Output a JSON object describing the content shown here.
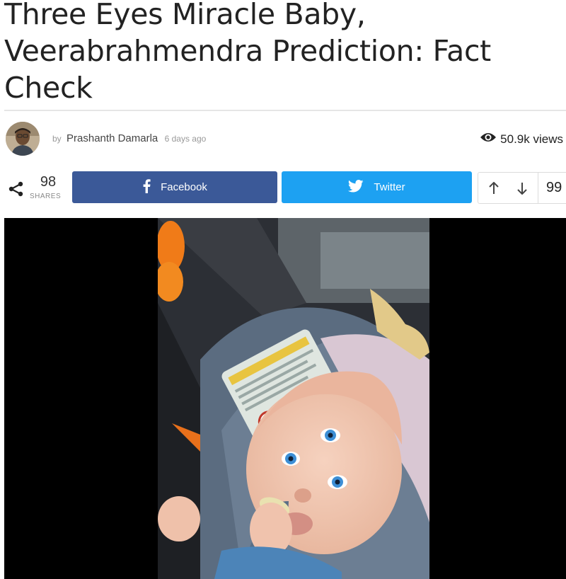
{
  "article": {
    "title_lines": [
      "Three Eyes Miracle Baby,",
      "Veerabrahmendra Prediction: Fact",
      "Check"
    ]
  },
  "meta": {
    "by_label": "by",
    "author": "Prashanth Damarla",
    "date": "6 days ago",
    "views": "50.9k views"
  },
  "share": {
    "count": "98",
    "count_label": "SHARES",
    "facebook_label": "Facebook",
    "twitter_label": "Twitter",
    "facebook_color": "#3b5998",
    "twitter_color": "#1da1f2"
  },
  "vote": {
    "score": "99"
  },
  "icons": {
    "views": "eye-icon",
    "share": "share-icon",
    "facebook": "facebook-icon",
    "twitter": "twitter-bird-icon",
    "upvote": "arrow-up-icon",
    "downvote": "arrow-down-icon"
  }
}
